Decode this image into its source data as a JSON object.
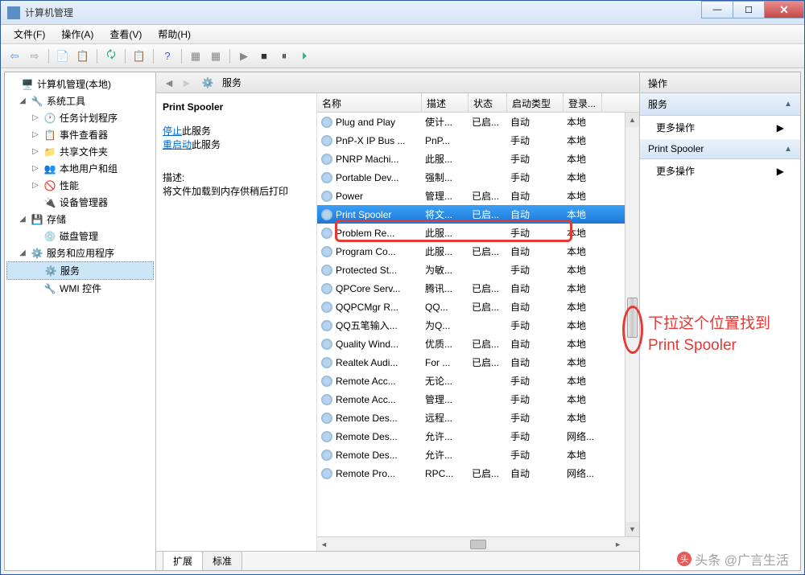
{
  "window": {
    "title": "计算机管理"
  },
  "menu": {
    "file": "文件(F)",
    "action": "操作(A)",
    "view": "查看(V)",
    "help": "帮助(H)"
  },
  "tree": {
    "root": "计算机管理(本地)",
    "systools": "系统工具",
    "scheduler": "任务计划程序",
    "eventviewer": "事件查看器",
    "shared": "共享文件夹",
    "users": "本地用户和组",
    "perf": "性能",
    "devmgr": "设备管理器",
    "storage": "存储",
    "diskmgmt": "磁盘管理",
    "svcapp": "服务和应用程序",
    "services": "服务",
    "wmi": "WMI 控件"
  },
  "center": {
    "title": "服务"
  },
  "detail": {
    "title": "Print Spooler",
    "stop": "停止",
    "stop_suffix": "此服务",
    "restart": "重启动",
    "restart_suffix": "此服务",
    "desc_label": "描述:",
    "desc_text": "将文件加载到内存供稍后打印"
  },
  "columns": {
    "name": "名称",
    "desc": "描述",
    "status": "状态",
    "startup": "启动类型",
    "logon": "登录..."
  },
  "services": [
    {
      "name": "Plug and Play",
      "desc": "使计...",
      "status": "已启...",
      "startup": "自动",
      "logon": "本地"
    },
    {
      "name": "PnP-X IP Bus ...",
      "desc": "PnP...",
      "status": "",
      "startup": "手动",
      "logon": "本地"
    },
    {
      "name": "PNRP Machi...",
      "desc": "此服...",
      "status": "",
      "startup": "手动",
      "logon": "本地"
    },
    {
      "name": "Portable Dev...",
      "desc": "强制...",
      "status": "",
      "startup": "手动",
      "logon": "本地"
    },
    {
      "name": "Power",
      "desc": "管理...",
      "status": "已启...",
      "startup": "自动",
      "logon": "本地"
    },
    {
      "name": "Print Spooler",
      "desc": "将文...",
      "status": "已启...",
      "startup": "自动",
      "logon": "本地",
      "selected": true
    },
    {
      "name": "Problem Re...",
      "desc": "此服...",
      "status": "",
      "startup": "手动",
      "logon": "本地"
    },
    {
      "name": "Program Co...",
      "desc": "此服...",
      "status": "已启...",
      "startup": "自动",
      "logon": "本地"
    },
    {
      "name": "Protected St...",
      "desc": "为敏...",
      "status": "",
      "startup": "手动",
      "logon": "本地"
    },
    {
      "name": "QPCore Serv...",
      "desc": "腾讯...",
      "status": "已启...",
      "startup": "自动",
      "logon": "本地"
    },
    {
      "name": "QQPCMgr R...",
      "desc": "QQ...",
      "status": "已启...",
      "startup": "自动",
      "logon": "本地"
    },
    {
      "name": "QQ五笔输入...",
      "desc": "为Q...",
      "status": "",
      "startup": "手动",
      "logon": "本地"
    },
    {
      "name": "Quality Wind...",
      "desc": "优质...",
      "status": "已启...",
      "startup": "自动",
      "logon": "本地"
    },
    {
      "name": "Realtek Audi...",
      "desc": "For ...",
      "status": "已启...",
      "startup": "自动",
      "logon": "本地"
    },
    {
      "name": "Remote Acc...",
      "desc": "无论...",
      "status": "",
      "startup": "手动",
      "logon": "本地"
    },
    {
      "name": "Remote Acc...",
      "desc": "管理...",
      "status": "",
      "startup": "手动",
      "logon": "本地"
    },
    {
      "name": "Remote Des...",
      "desc": "远程...",
      "status": "",
      "startup": "手动",
      "logon": "本地"
    },
    {
      "name": "Remote Des...",
      "desc": "允许...",
      "status": "",
      "startup": "手动",
      "logon": "网络..."
    },
    {
      "name": "Remote Des...",
      "desc": "允许...",
      "status": "",
      "startup": "手动",
      "logon": "本地"
    },
    {
      "name": "Remote Pro...",
      "desc": "RPC...",
      "status": "已启...",
      "startup": "自动",
      "logon": "网络..."
    }
  ],
  "tabs": {
    "ext": "扩展",
    "std": "标准"
  },
  "actions": {
    "header": "操作",
    "services": "服务",
    "more": "更多操作",
    "spooler": "Print Spooler"
  },
  "annotation": "下拉这个位置找到Print Spooler",
  "watermark": "头条 @广言生活"
}
